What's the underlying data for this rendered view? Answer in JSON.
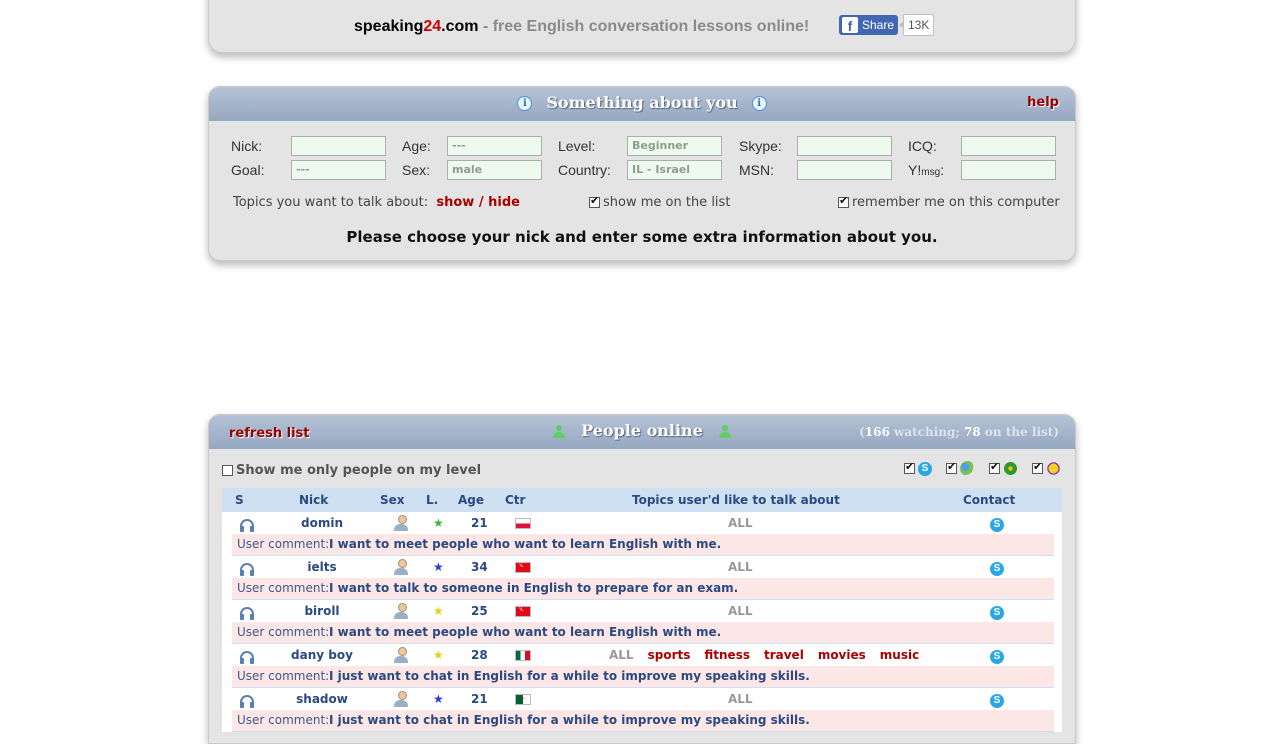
{
  "banner": {
    "brand_a": "speaking",
    "brand_b": "24",
    "brand_c": ".com",
    "tagline": " - free English conversation lessons online!",
    "share_label": "Share",
    "share_count": "13K"
  },
  "about": {
    "title": "Something about you",
    "help": "help",
    "labels": {
      "nick": "Nick:",
      "age": "Age:",
      "level": "Level:",
      "skype": "Skype:",
      "icq": "ICQ:",
      "goal": "Goal:",
      "sex": "Sex:",
      "country": "Country:",
      "msn": "MSN:",
      "ymsg_a": "Y!",
      "ymsg_b": "msg",
      "ymsg_c": ":"
    },
    "values": {
      "nick": "",
      "age": "---",
      "level": "Beginner",
      "skype": "",
      "icq": "",
      "goal": "---",
      "sex": "male",
      "country": "IL - Israel",
      "msn": "",
      "ymsg": ""
    },
    "topics_label": "Topics you want to talk about:",
    "topics_link": "show / hide",
    "show_on_list": "show me on the list",
    "remember": "remember me on this computer",
    "notice": "Please choose your nick and enter some extra information about you."
  },
  "people": {
    "refresh": "refresh list",
    "title": "People online",
    "watching_count": "166",
    "watching_label": "watching;",
    "list_count": "78",
    "list_label": "on the list",
    "level_only": "Show me only people on my level",
    "columns": {
      "s": "S",
      "nick": "Nick",
      "sex": "Sex",
      "level": "L.",
      "age": "Age",
      "country": "Ctr",
      "topics": "Topics user'd like to talk about",
      "contact": "Contact"
    },
    "comment_label": "User comment:",
    "users": [
      {
        "nick": "domin",
        "age": "21",
        "star_color": "#3cb63c",
        "flag": "pl",
        "topics": [
          "ALL"
        ],
        "comment": "I want to meet people who want to learn English with me."
      },
      {
        "nick": "ielts",
        "age": "34",
        "star_color": "#2a3ccf",
        "flag": "tr",
        "topics": [
          "ALL"
        ],
        "comment": "I want to talk to someone in English to prepare for an exam."
      },
      {
        "nick": "biroll",
        "age": "25",
        "star_color": "#e0d020",
        "flag": "tr",
        "topics": [
          "ALL"
        ],
        "comment": "I want to meet people who want to learn English with me."
      },
      {
        "nick": "dany boy",
        "age": "28",
        "star_color": "#e0d020",
        "flag": "mx",
        "topics": [
          "ALL",
          "sports",
          "fitness",
          "travel",
          "movies",
          "music"
        ],
        "comment": "I just want to chat in English for a while to improve my speaking skills."
      },
      {
        "nick": "shadow",
        "age": "21",
        "star_color": "#2a3ccf",
        "flag": "dz",
        "topics": [
          "ALL"
        ],
        "comment": "I just want to chat in English for a while to improve my speaking skills."
      }
    ]
  }
}
